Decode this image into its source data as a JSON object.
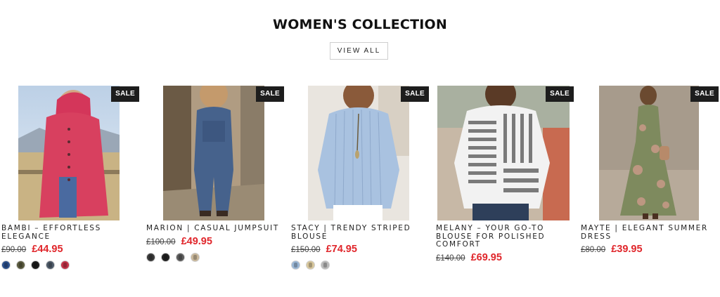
{
  "section": {
    "title": "WOMEN'S COLLECTION",
    "view_all_label": "VIEW ALL"
  },
  "products": [
    {
      "name": "BAMBI – EFFORTLESS ELEGANCE",
      "badge": "SALE",
      "old_price": "£90.00",
      "new_price": "£44.95",
      "swatches": [
        "#2b4f8a",
        "#5a5a3e",
        "#1b1b1b",
        "#4e5a68",
        "#c23348"
      ]
    },
    {
      "name": "MARION | CASUAL JUMPSUIT",
      "badge": "SALE",
      "old_price": "£100.00",
      "new_price": "£49.95",
      "swatches": [
        "#3a3a3a",
        "#222222",
        "#5c5c5c",
        "#c9b79a"
      ]
    },
    {
      "name": "STACY | TRENDY STRIPED BLOUSE",
      "badge": "SALE",
      "old_price": "£150.00",
      "new_price": "£74.95",
      "swatches": [
        "#9ab7d6",
        "#d8c79c",
        "#b9b9b9"
      ]
    },
    {
      "name": "MELANY – YOUR GO-TO BLOUSE FOR POLISHED COMFORT",
      "badge": "SALE",
      "old_price": "£140.00",
      "new_price": "£69.95",
      "swatches": []
    },
    {
      "name": "MAYTE | ELEGANT SUMMER DRESS",
      "badge": "SALE",
      "old_price": "£80.00",
      "new_price": "£39.95",
      "swatches": []
    }
  ],
  "colors": {
    "sale_price": "#e0262b",
    "badge_bg": "#1d1d1d"
  }
}
